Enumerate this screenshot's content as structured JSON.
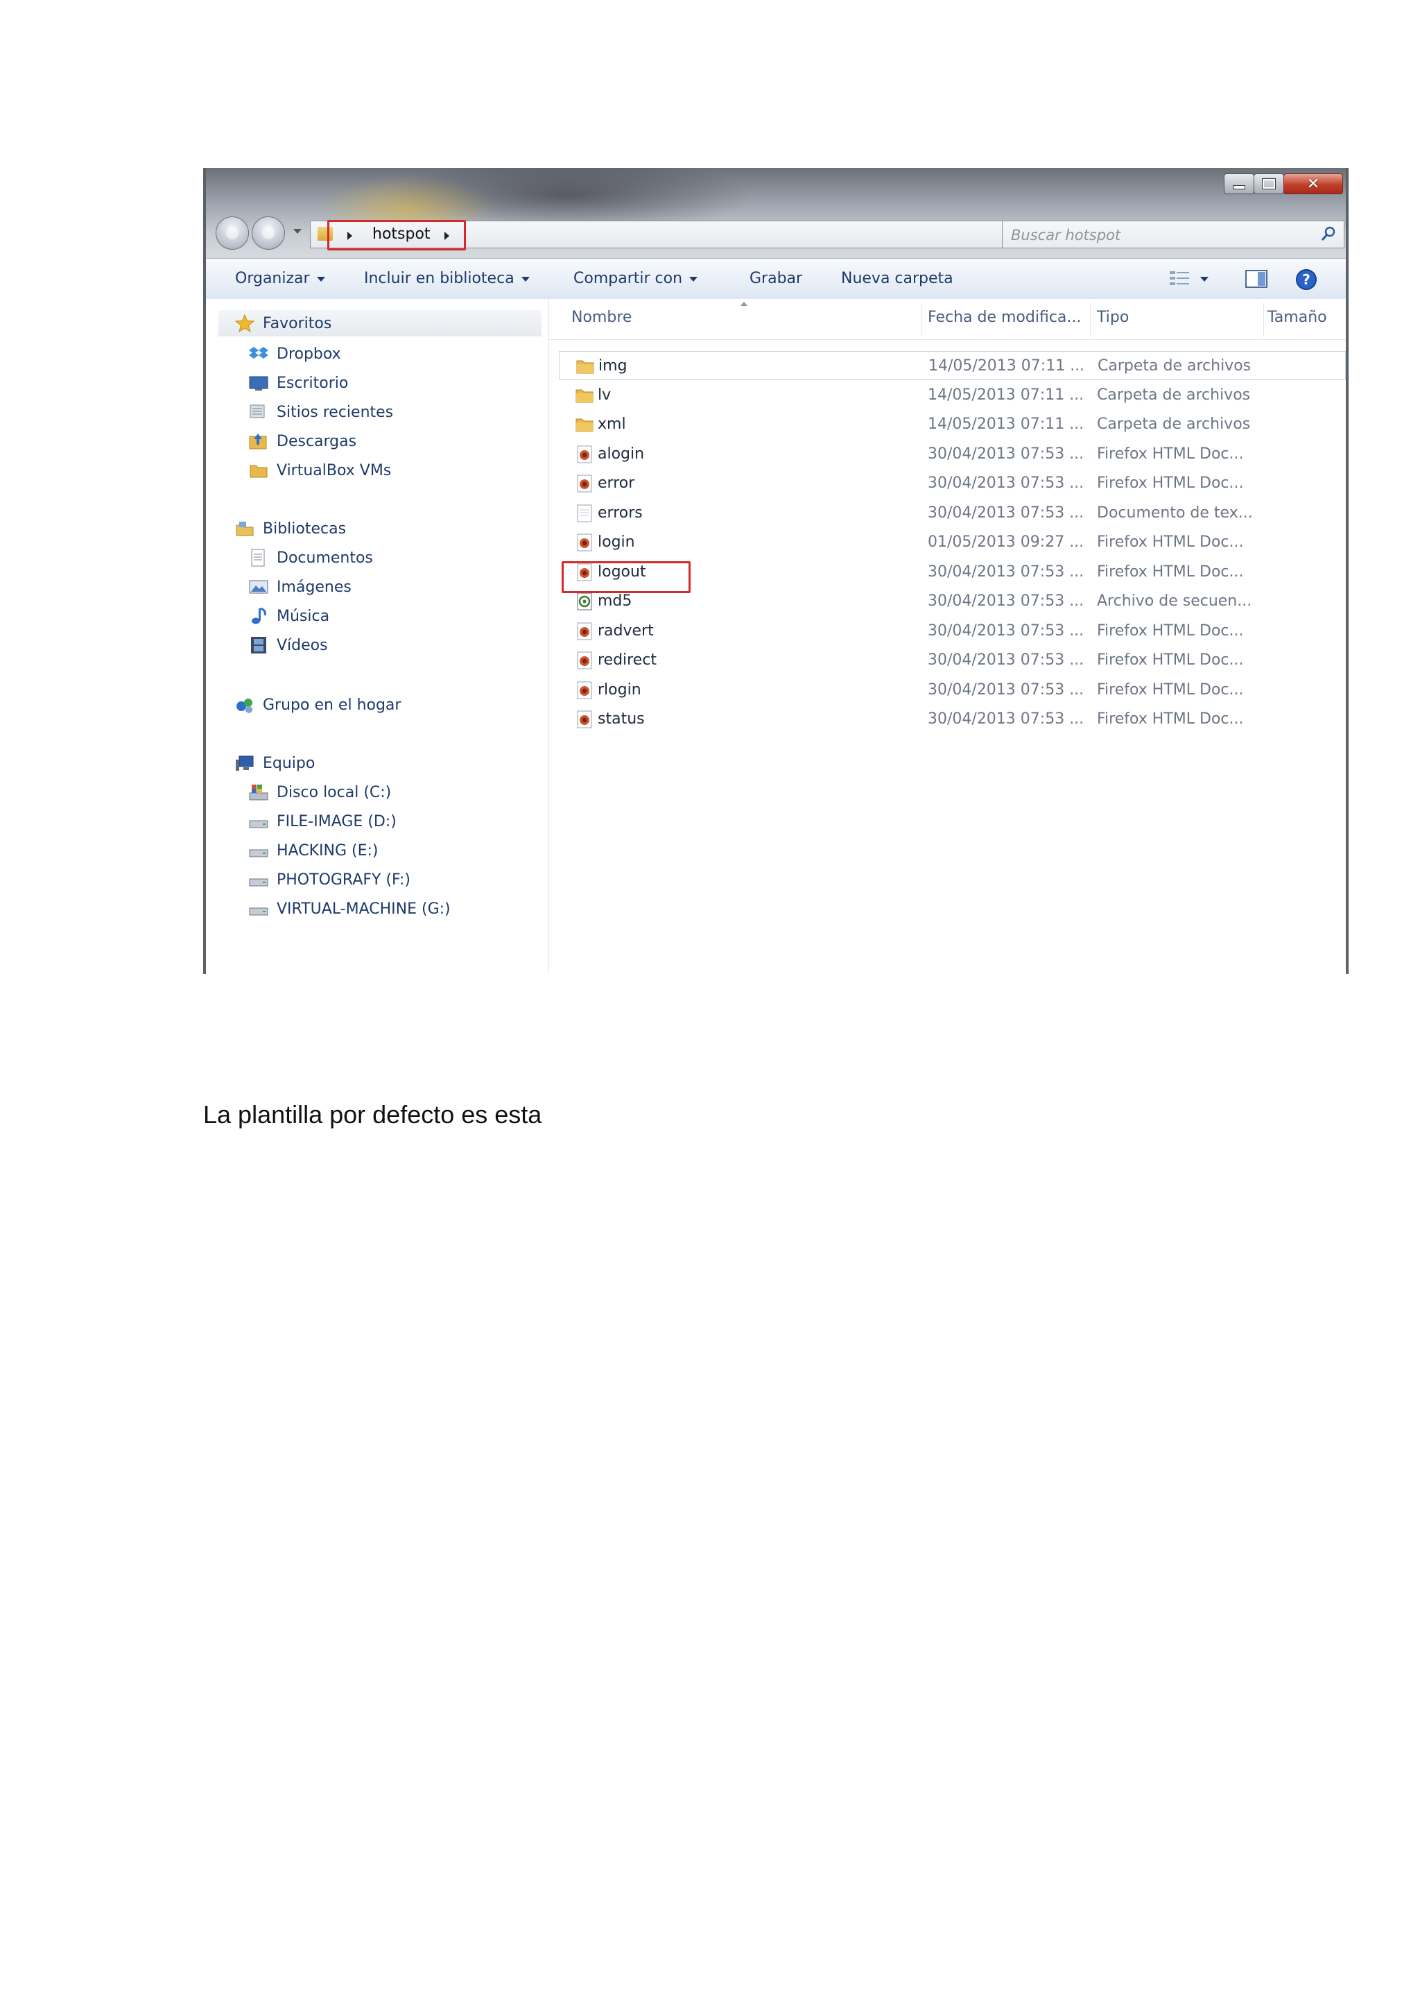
{
  "window": {
    "breadcrumb": "hotspot",
    "search_placeholder": "Buscar hotspot"
  },
  "toolbar": {
    "organize": "Organizar",
    "include_library": "Incluir en biblioteca",
    "share": "Compartir con",
    "burn": "Grabar",
    "new_folder": "Nueva carpeta"
  },
  "nav": {
    "favorites": {
      "label": "Favoritos",
      "items": [
        "Dropbox",
        "Escritorio",
        "Sitios recientes",
        "Descargas",
        "VirtualBox VMs"
      ]
    },
    "libraries": {
      "label": "Bibliotecas",
      "items": [
        "Documentos",
        "Imágenes",
        "Música",
        "Vídeos"
      ]
    },
    "homegroup": "Grupo en el hogar",
    "computer": {
      "label": "Equipo",
      "items": [
        "Disco local (C:)",
        "FILE-IMAGE (D:)",
        "HACKING (E:)",
        "PHOTOGRAFY (F:)",
        "VIRTUAL-MACHINE (G:)"
      ]
    }
  },
  "columns": {
    "name": "Nombre",
    "date": "Fecha de modifica...",
    "type": "Tipo",
    "size": "Tamaño"
  },
  "files": [
    {
      "name": "img",
      "date": "14/05/2013 07:11 ...",
      "type": "Carpeta de archivos",
      "icon": "folder-icon"
    },
    {
      "name": "lv",
      "date": "14/05/2013 07:11 ...",
      "type": "Carpeta de archivos",
      "icon": "folder-icon"
    },
    {
      "name": "xml",
      "date": "14/05/2013 07:11 ...",
      "type": "Carpeta de archivos",
      "icon": "folder-icon"
    },
    {
      "name": "alogin",
      "date": "30/04/2013 07:53 ...",
      "type": "Firefox HTML Doc...",
      "icon": "firefox-html-icon"
    },
    {
      "name": "error",
      "date": "30/04/2013 07:53 ...",
      "type": "Firefox HTML Doc...",
      "icon": "firefox-html-icon"
    },
    {
      "name": "errors",
      "date": "30/04/2013 07:53 ...",
      "type": "Documento de tex...",
      "icon": "text-document-icon"
    },
    {
      "name": "login",
      "date": "01/05/2013 09:27 ...",
      "type": "Firefox HTML Doc...",
      "icon": "firefox-html-icon"
    },
    {
      "name": "logout",
      "date": "30/04/2013 07:53 ...",
      "type": "Firefox HTML Doc...",
      "icon": "firefox-html-icon"
    },
    {
      "name": "md5",
      "date": "30/04/2013 07:53 ...",
      "type": "Archivo de secuen...",
      "icon": "script-file-icon"
    },
    {
      "name": "radvert",
      "date": "30/04/2013 07:53 ...",
      "type": "Firefox HTML Doc...",
      "icon": "firefox-html-icon"
    },
    {
      "name": "redirect",
      "date": "30/04/2013 07:53 ...",
      "type": "Firefox HTML Doc...",
      "icon": "firefox-html-icon"
    },
    {
      "name": "rlogin",
      "date": "30/04/2013 07:53 ...",
      "type": "Firefox HTML Doc...",
      "icon": "firefox-html-icon"
    },
    {
      "name": "status",
      "date": "30/04/2013 07:53 ...",
      "type": "Firefox HTML Doc...",
      "icon": "firefox-html-icon"
    }
  ],
  "caption": "La plantilla por defecto es esta",
  "colors": {
    "highlight_box": "#d42a2a",
    "nav_text": "#1e3a6a",
    "folder": "#e8b94a"
  }
}
